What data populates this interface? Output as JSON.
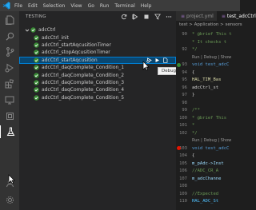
{
  "titlebar": {
    "menu": [
      "File",
      "Edit",
      "Selection",
      "View",
      "Go",
      "Run",
      "Terminal",
      "Help"
    ]
  },
  "activitybar": {
    "icons": [
      "files-icon",
      "search-icon",
      "source-control-icon",
      "run-debug-icon",
      "extensions-icon",
      "remote-explorer-icon",
      "device-icon",
      "testing-icon"
    ]
  },
  "sidebar": {
    "title": "TESTING",
    "root": {
      "label": "adcCtrl",
      "status": "passed",
      "expanded": true
    },
    "items": [
      {
        "label": "adcCtrl_init",
        "status": "passed"
      },
      {
        "label": "adcCtrl_startAqcusitionTimer",
        "status": "passed"
      },
      {
        "label": "adcCtrl_stopAqcusitionTimer",
        "status": "passed"
      },
      {
        "label": "adcCtrl_startAqcusition",
        "status": "passed",
        "selected": true
      },
      {
        "label": "adcCtrl_daqComplete_Condition_1",
        "status": "passed"
      },
      {
        "label": "adcCtrl_daqComplete_Condition_2",
        "status": "passed"
      },
      {
        "label": "adcCtrl_daqComplete_Condition_3",
        "status": "passed"
      },
      {
        "label": "adcCtrl_daqComplete_Condition_4",
        "status": "passed"
      },
      {
        "label": "adcCtrl_daqComplete_Condition_5",
        "status": "passed"
      }
    ],
    "tooltip": "Debug this test",
    "tooltip_overlap": "Acqusition"
  },
  "editor": {
    "tabs": [
      {
        "label": "project.yml",
        "active": false
      },
      {
        "label": "test_adcCtrl.c",
        "active": true
      }
    ],
    "breadcrumb": "test > Application > sensors",
    "lines": [
      {
        "n": "90",
        "text": " * @brief This t",
        "cls": "c-comment"
      },
      {
        "n": "",
        "text": " * It checks t",
        "cls": "c-comment"
      },
      {
        "n": "92",
        "text": " */",
        "cls": "c-comment"
      },
      {
        "n": "",
        "text": "Run | Debug | Show",
        "cls": "codelens"
      },
      {
        "n": "93",
        "text": "void test_adcC",
        "cls": "c-kw",
        "mark": "pass"
      },
      {
        "n": "94",
        "text": "{",
        "cls": "c-plain"
      },
      {
        "n": "95",
        "text": "  HAL_TIM_Bas",
        "cls": "c-fn"
      },
      {
        "n": "96",
        "text": "  adcCtrl_st",
        "cls": "c-plain"
      },
      {
        "n": "97",
        "text": "}",
        "cls": "c-plain"
      },
      {
        "n": "98",
        "text": "",
        "cls": "c-plain"
      },
      {
        "n": "99",
        "text": "/**",
        "cls": "c-comment"
      },
      {
        "n": "100",
        "text": " * @brief This",
        "cls": "c-comment"
      },
      {
        "n": "101",
        "text": " *",
        "cls": "c-comment"
      },
      {
        "n": "102",
        "text": " */",
        "cls": "c-comment"
      },
      {
        "n": "",
        "text": "Run | Debug | Show",
        "cls": "codelens"
      },
      {
        "n": "103",
        "text": "void test_adcC",
        "cls": "c-kw",
        "mark": "fail"
      },
      {
        "n": "104",
        "text": "{",
        "cls": "c-plain"
      },
      {
        "n": "105",
        "text": "  m_pAdc->Inst",
        "cls": "c-var"
      },
      {
        "n": "106",
        "text": "  //ADC_CR_A",
        "cls": "c-comment"
      },
      {
        "n": "107",
        "text": "  m_adcChanne",
        "cls": "c-var"
      },
      {
        "n": "108",
        "text": "",
        "cls": "c-plain"
      },
      {
        "n": "109",
        "text": "  //Expected",
        "cls": "c-comment"
      },
      {
        "n": "110",
        "text": "  HAL_ADC_St",
        "cls": "c-const"
      }
    ]
  },
  "colors": {
    "pass": "#388a34",
    "fail": "#e51400",
    "selection": "#094771",
    "accent": "#007acc"
  }
}
